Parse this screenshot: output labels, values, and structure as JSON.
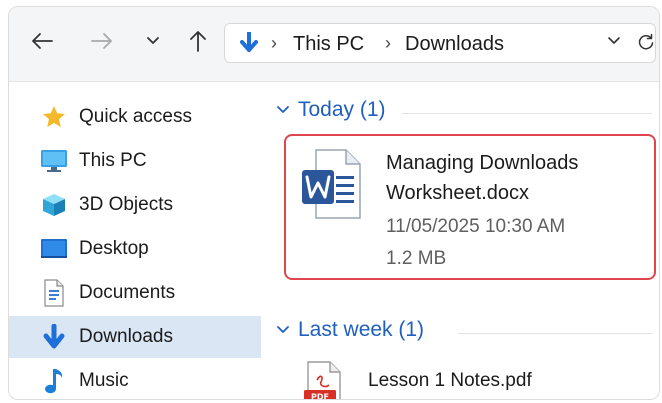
{
  "toolbar": {
    "back_icon": "arrow-left-icon",
    "forward_icon": "arrow-right-icon",
    "recent_icon": "chevron-down-icon",
    "up_icon": "arrow-up-icon",
    "refresh_icon": "refresh-icon"
  },
  "address": {
    "icon": "download-arrow-icon",
    "crumbs": [
      "This PC",
      "Downloads"
    ]
  },
  "sidebar": {
    "items": [
      {
        "label": "Quick access",
        "icon": "star-icon"
      },
      {
        "label": "This PC",
        "icon": "monitor-icon"
      },
      {
        "label": "3D Objects",
        "icon": "cube-icon"
      },
      {
        "label": "Desktop",
        "icon": "desktop-icon"
      },
      {
        "label": "Documents",
        "icon": "document-icon"
      },
      {
        "label": "Downloads",
        "icon": "download-arrow-icon",
        "selected": true
      },
      {
        "label": "Music",
        "icon": "music-note-icon"
      }
    ]
  },
  "groups": {
    "today": {
      "title": "Today (1)",
      "file": {
        "name": "Managing Downloads Worksheet.docx",
        "date": "11/05/2025  10:30 AM",
        "size": "1.2 MB",
        "icon": "word-document-icon"
      }
    },
    "last_week": {
      "title": "Last week (1)",
      "file": {
        "name": "Lesson 1 Notes.pdf",
        "icon": "pdf-document-icon"
      }
    }
  },
  "colors": {
    "accent": "#1f5fbf",
    "selection": "#dbe6f5",
    "highlight_border": "#e0454e",
    "word_blue": "#2b579a",
    "pdf_red": "#d93025"
  }
}
